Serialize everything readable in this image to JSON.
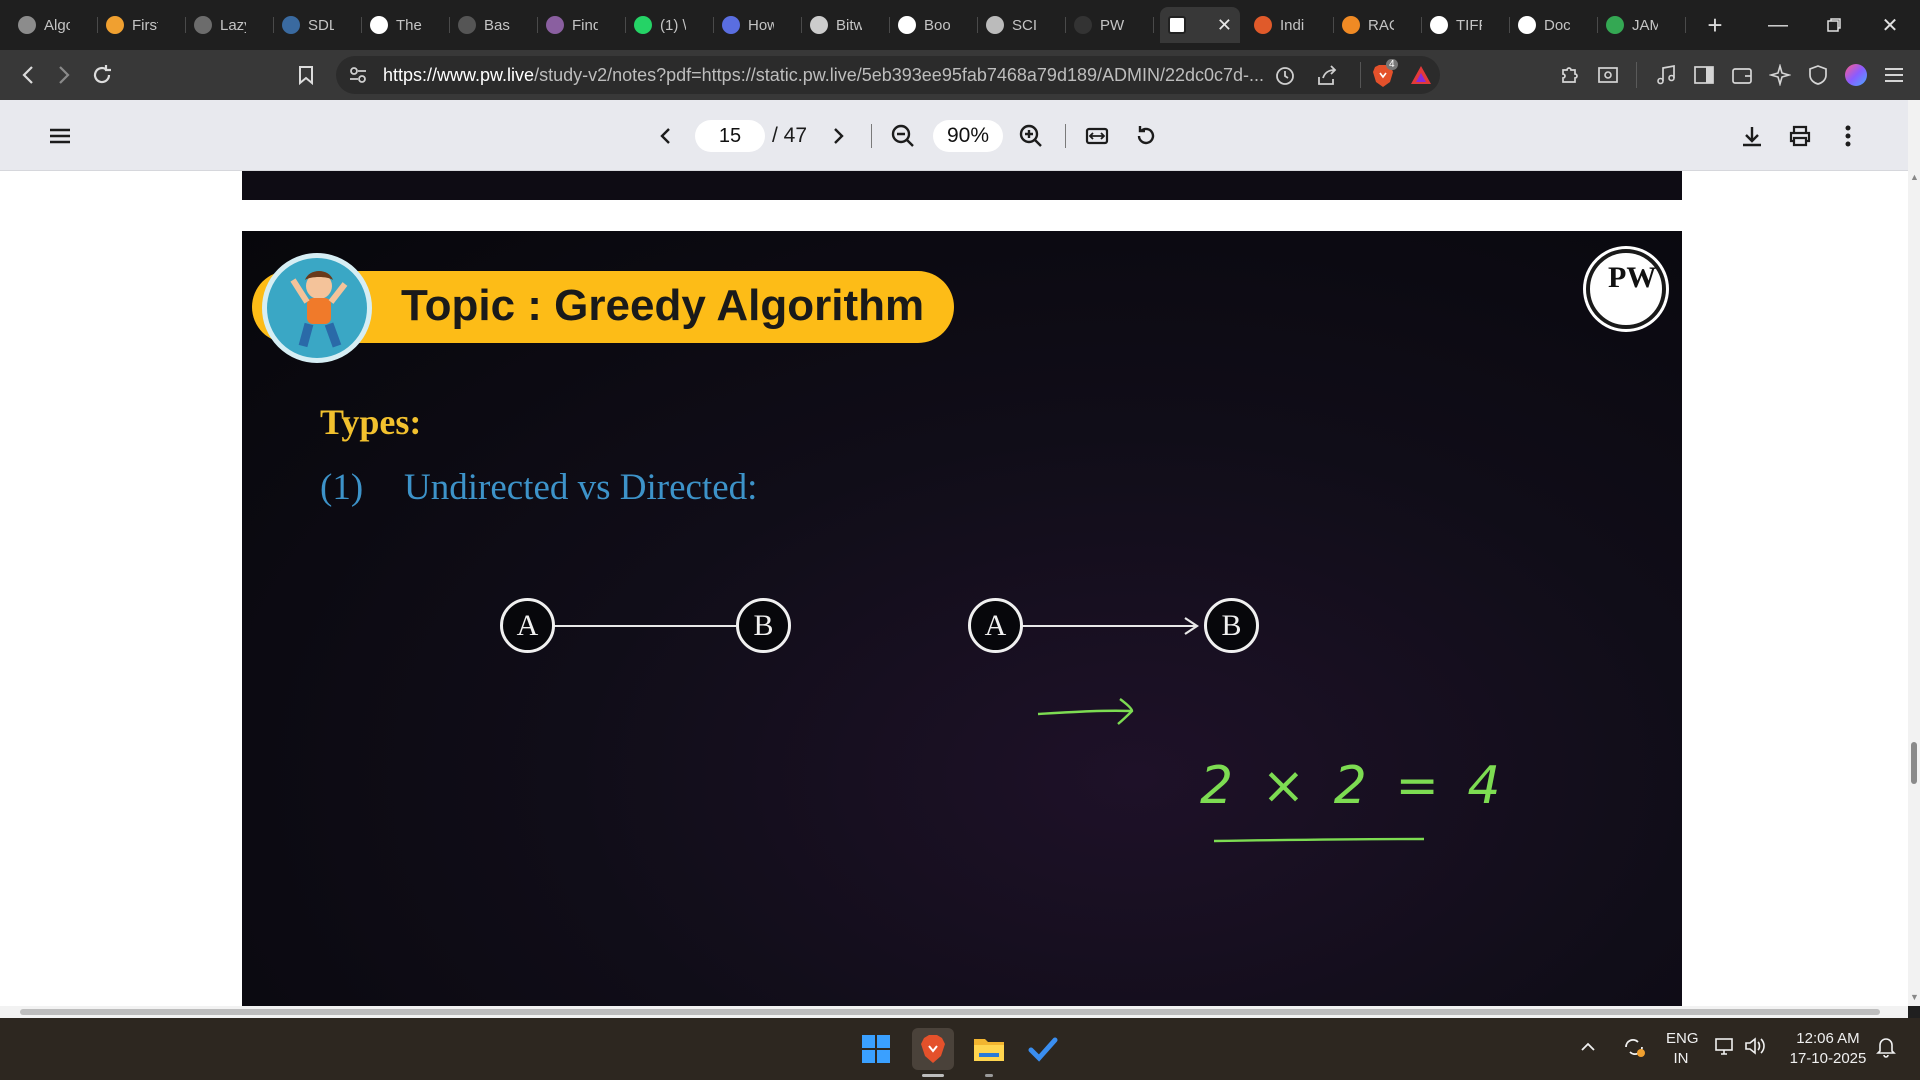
{
  "tabs": [
    {
      "title": "Algo",
      "favicon": "github-icon",
      "color": "#8c8c8c"
    },
    {
      "title": "First",
      "favicon": "lightning-icon",
      "color": "#f0a030"
    },
    {
      "title": "Lazy",
      "favicon": "globe-icon",
      "color": "#6c6c6c"
    },
    {
      "title": "SDL",
      "favicon": "bars-icon",
      "color": "#3a6aa0"
    },
    {
      "title": "The",
      "favicon": "wave-icon",
      "color": "#ffffff"
    },
    {
      "title": "Basi",
      "favicon": "doc-icon",
      "color": "#555555"
    },
    {
      "title": "Find",
      "favicon": "cloud-icon",
      "color": "#8a5fa0"
    },
    {
      "title": "(1) \\",
      "favicon": "whatsapp-icon",
      "color": "#25d366"
    },
    {
      "title": "How",
      "favicon": "shield-icon",
      "color": "#5a6ee0"
    },
    {
      "title": "Bitw",
      "favicon": "text-icon",
      "color": "#cccccc"
    },
    {
      "title": "Boo",
      "favicon": "google-icon",
      "color": "#ffffff"
    },
    {
      "title": "SCIE",
      "favicon": "globe-icon",
      "color": "#bbbbbb"
    },
    {
      "title": "PW",
      "favicon": "pw-icon",
      "color": "#333333"
    },
    {
      "title": "",
      "favicon": "pw-logo-icon",
      "color": "#ffffff",
      "active": true
    },
    {
      "title": "Indi",
      "favicon": "burger-icon",
      "color": "#e05a2a"
    },
    {
      "title": "RAC",
      "favicon": "flag-icon",
      "color": "#f08a24"
    },
    {
      "title": "TIFF",
      "favicon": "google-icon",
      "color": "#ffffff"
    },
    {
      "title": "Doc",
      "favicon": "google-icon",
      "color": "#ffffff"
    },
    {
      "title": "JAM",
      "favicon": "map-pin-icon",
      "color": "#34a853"
    }
  ],
  "address_bar": {
    "url_host": "https://www.pw.live",
    "url_path": "/study-v2/notes?pdf=https://static.pw.live/5eb393ee95fab7468a79d189/ADMIN/22dc0c7d-...",
    "brave_badge": "4"
  },
  "pdf_toolbar": {
    "page_current": "15",
    "page_total": "/ 47",
    "zoom": "90%"
  },
  "slide": {
    "topic_title": "Topic : Greedy Algorithm",
    "logo_text": "PW",
    "types_label": "Types:",
    "item_number": "(1)",
    "item_text": "Undirected vs Directed:",
    "undirected": {
      "from": "A",
      "to": "B"
    },
    "directed": {
      "from": "A",
      "to": "B"
    },
    "handwritten_equation": "2 × 2 = 4"
  },
  "taskbar": {
    "lang_top": "ENG",
    "lang_bottom": "IN",
    "time": "12:06 AM",
    "date": "17-10-2025"
  },
  "colors": {
    "slide_accent": "#fdbc17",
    "heading_gold": "#f2c12e",
    "body_blue": "#3d93c9",
    "ink_green": "#7ddc52"
  }
}
